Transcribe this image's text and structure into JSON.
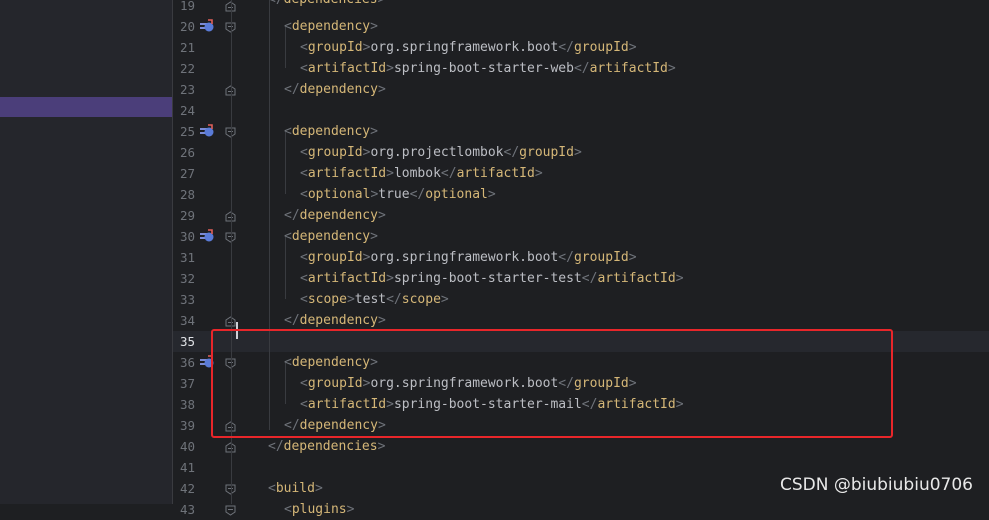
{
  "editor": {
    "lines": [
      {
        "n": "19",
        "kind": "partial",
        "indent": 2,
        "tag": "dependencies"
      },
      {
        "n": "20",
        "kind": "open",
        "indent": 3,
        "tag": "dependency",
        "maven": true
      },
      {
        "n": "21",
        "kind": "elem",
        "indent": 4,
        "tag": "groupId",
        "value": "org.springframework.boot"
      },
      {
        "n": "22",
        "kind": "elem",
        "indent": 4,
        "tag": "artifactId",
        "value": "spring-boot-starter-web"
      },
      {
        "n": "23",
        "kind": "close",
        "indent": 3,
        "tag": "dependency"
      },
      {
        "n": "24",
        "kind": "blank"
      },
      {
        "n": "25",
        "kind": "open",
        "indent": 3,
        "tag": "dependency",
        "maven": true
      },
      {
        "n": "26",
        "kind": "elem",
        "indent": 4,
        "tag": "groupId",
        "value": "org.projectlombok"
      },
      {
        "n": "27",
        "kind": "elem",
        "indent": 4,
        "tag": "artifactId",
        "value": "lombok"
      },
      {
        "n": "28",
        "kind": "elem",
        "indent": 4,
        "tag": "optional",
        "value": "true"
      },
      {
        "n": "29",
        "kind": "close",
        "indent": 3,
        "tag": "dependency"
      },
      {
        "n": "30",
        "kind": "open",
        "indent": 3,
        "tag": "dependency",
        "maven": true
      },
      {
        "n": "31",
        "kind": "elem",
        "indent": 4,
        "tag": "groupId",
        "value": "org.springframework.boot"
      },
      {
        "n": "32",
        "kind": "elem",
        "indent": 4,
        "tag": "artifactId",
        "value": "spring-boot-starter-test"
      },
      {
        "n": "33",
        "kind": "elem",
        "indent": 4,
        "tag": "scope",
        "value": "test"
      },
      {
        "n": "34",
        "kind": "close",
        "indent": 3,
        "tag": "dependency"
      },
      {
        "n": "35",
        "kind": "blank",
        "current": true
      },
      {
        "n": "36",
        "kind": "open",
        "indent": 3,
        "tag": "dependency",
        "maven": true
      },
      {
        "n": "37",
        "kind": "elem",
        "indent": 4,
        "tag": "groupId",
        "value": "org.springframework.boot"
      },
      {
        "n": "38",
        "kind": "elem",
        "indent": 4,
        "tag": "artifactId",
        "value": "spring-boot-starter-mail"
      },
      {
        "n": "39",
        "kind": "close",
        "indent": 3,
        "tag": "dependency"
      },
      {
        "n": "40",
        "kind": "close",
        "indent": 2,
        "tag": "dependencies"
      },
      {
        "n": "41",
        "kind": "blank"
      },
      {
        "n": "42",
        "kind": "open",
        "indent": 2,
        "tag": "build"
      },
      {
        "n": "43",
        "kind": "open",
        "indent": 3,
        "tag": "plugins"
      }
    ]
  },
  "watermark": "CSDN @biubiubiu0706",
  "colors": {
    "background": "#1e1f22",
    "tag": "#d5b778",
    "bracket": "#6f737a",
    "text": "#bcbec4",
    "line_number": "#6f737a",
    "highlight_box": "#e8262a",
    "sidebar_selected": "#4b3e7a"
  }
}
